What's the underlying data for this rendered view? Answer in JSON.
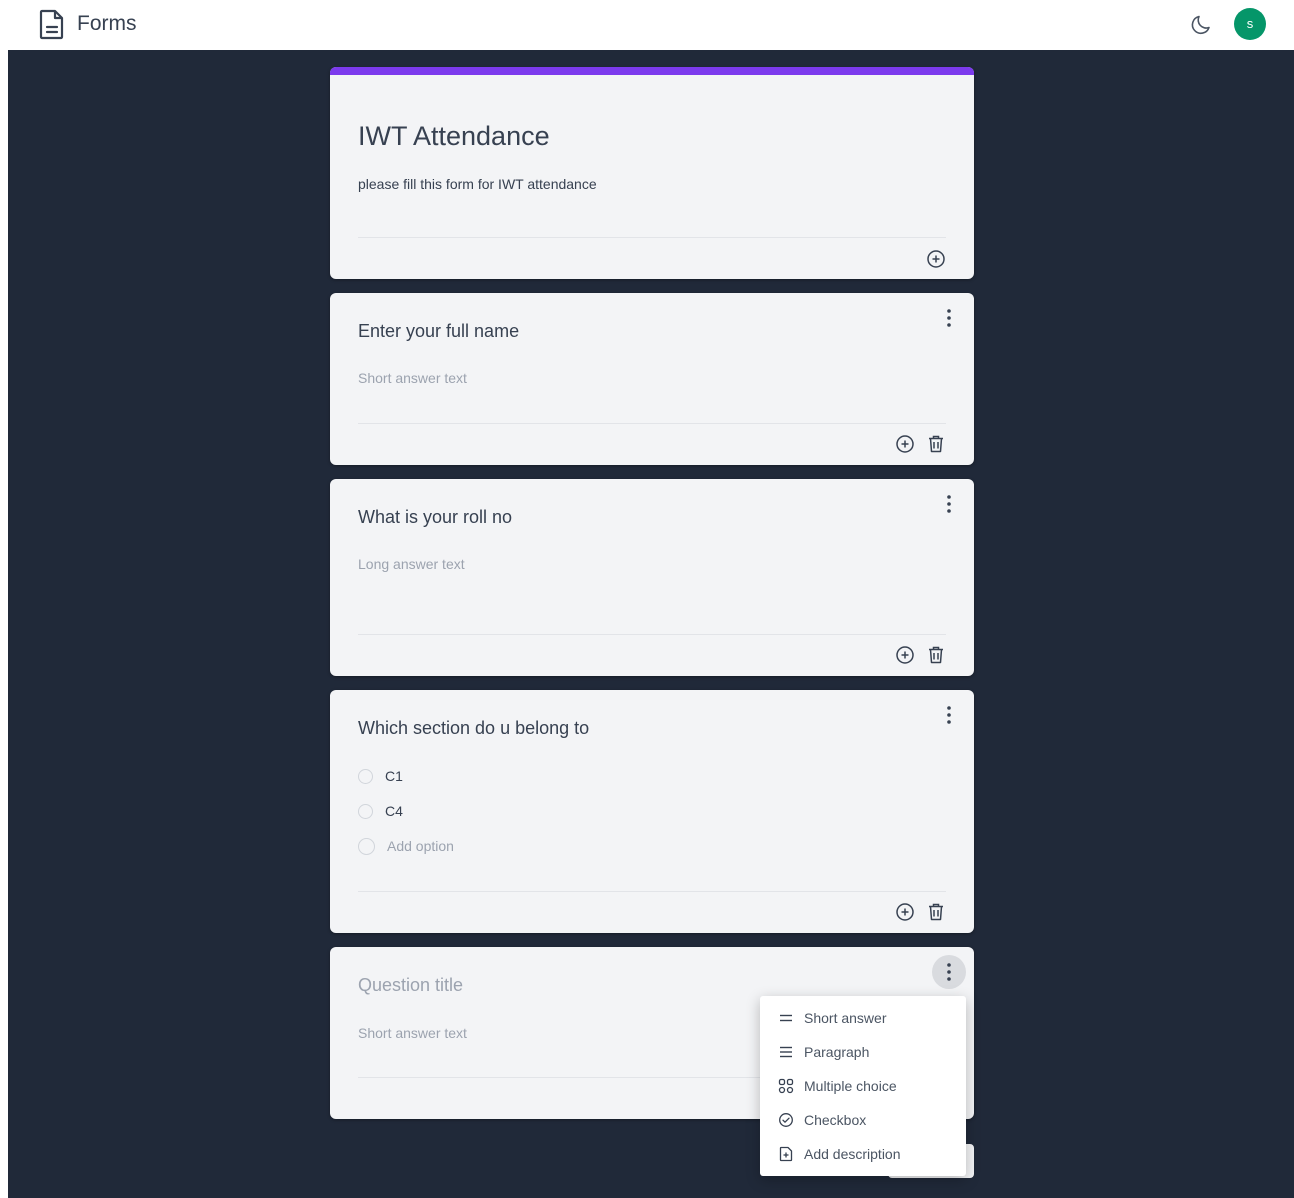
{
  "app": {
    "title": "Forms",
    "user_initial": "s"
  },
  "form": {
    "title": "IWT Attendance",
    "description": "please fill this form for IWT attendance"
  },
  "questions": [
    {
      "title": "Enter your full name",
      "hint": "Short answer text"
    },
    {
      "title": "What is your roll no",
      "hint": "Long answer text"
    },
    {
      "title": "Which section do u belong to",
      "options": [
        "C1",
        "C4"
      ],
      "add_option": "Add option"
    },
    {
      "title_placeholder": "Question title",
      "hint": "Short answer text"
    }
  ],
  "type_menu": {
    "items": [
      {
        "label": "Short answer",
        "icon": "short-answer-icon"
      },
      {
        "label": "Paragraph",
        "icon": "paragraph-icon"
      },
      {
        "label": "Multiple choice",
        "icon": "multiple-choice-icon"
      },
      {
        "label": "Checkbox",
        "icon": "checkbox-icon"
      },
      {
        "label": "Add description",
        "icon": "add-description-icon"
      }
    ]
  },
  "colors": {
    "accent": "#7c3aed",
    "background": "#202939",
    "card": "#f3f4f6",
    "avatar": "#059669"
  }
}
